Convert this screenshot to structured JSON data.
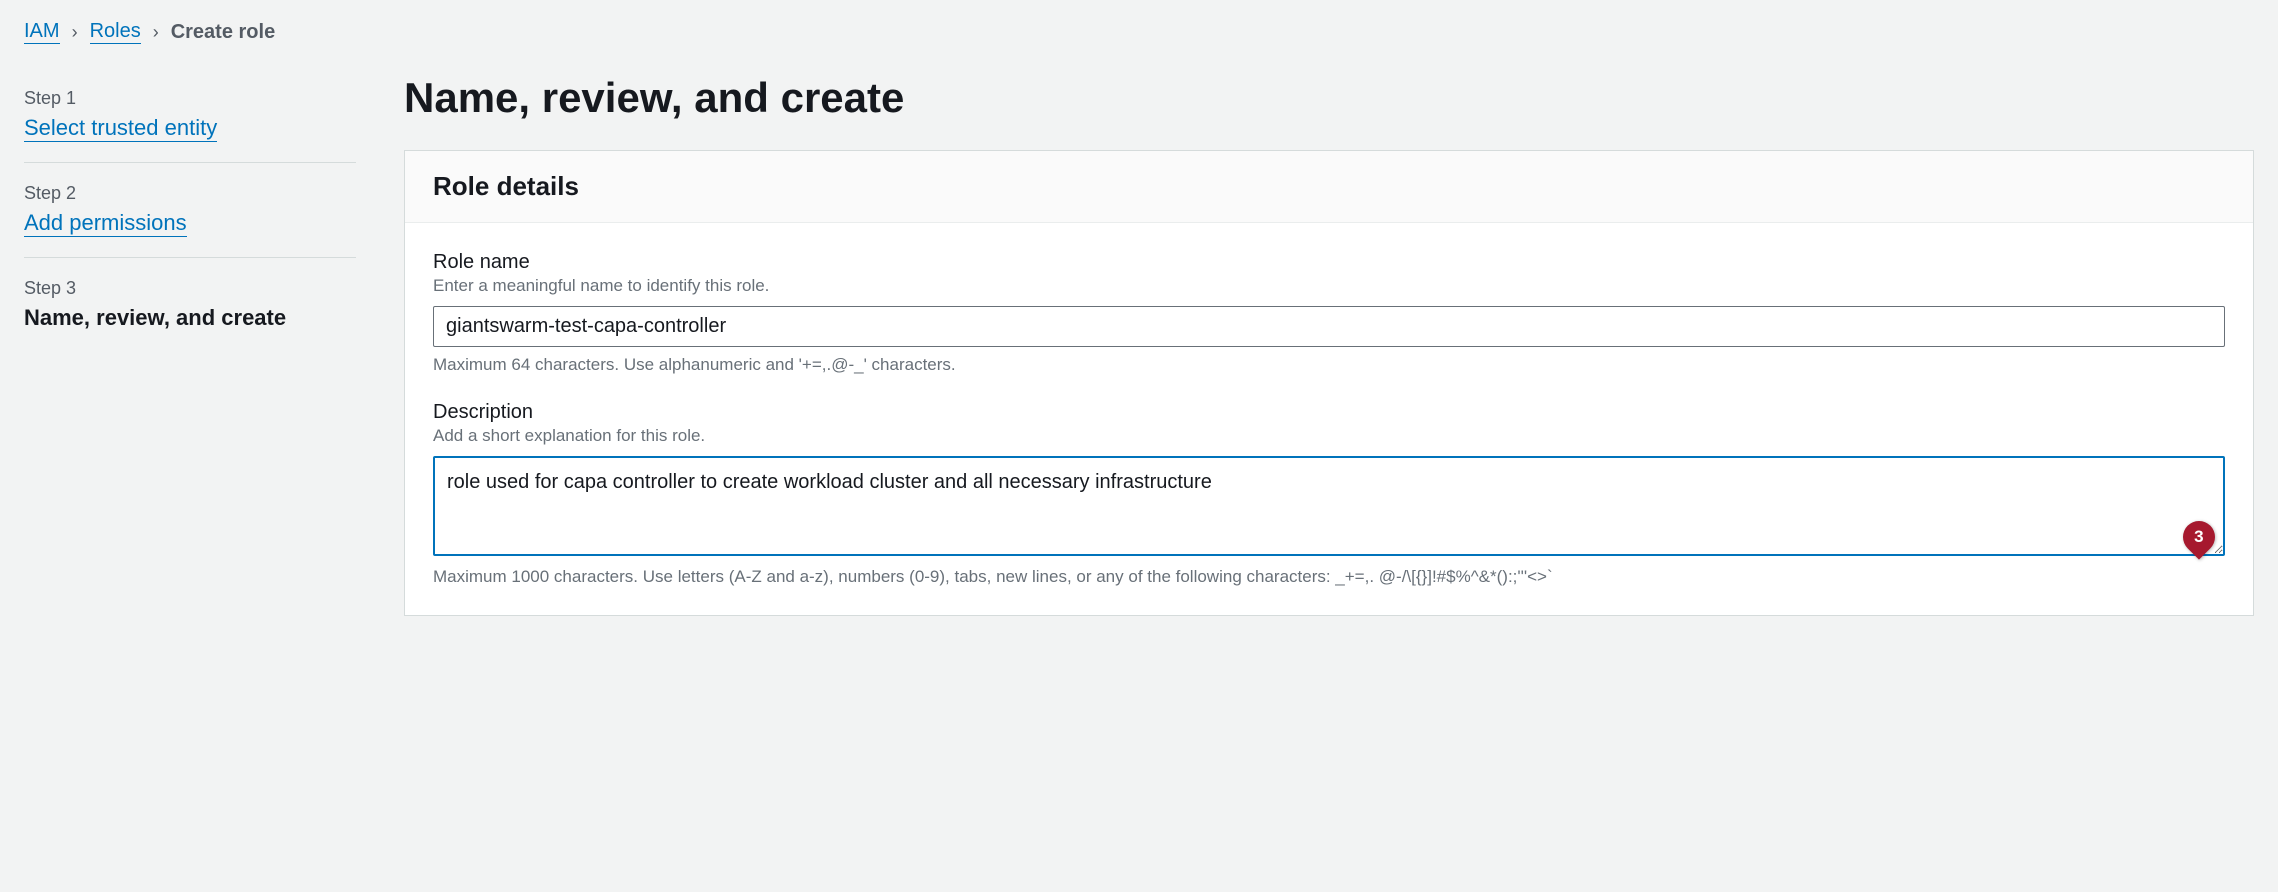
{
  "breadcrumb": {
    "items": [
      {
        "label": "IAM",
        "link": true
      },
      {
        "label": "Roles",
        "link": true
      },
      {
        "label": "Create role",
        "link": false
      }
    ]
  },
  "sidebar": {
    "steps": [
      {
        "step_label": "Step 1",
        "title": "Select trusted entity",
        "active": false,
        "link": true
      },
      {
        "step_label": "Step 2",
        "title": "Add permissions",
        "active": false,
        "link": true
      },
      {
        "step_label": "Step 3",
        "title": "Name, review, and create",
        "active": true,
        "link": false
      }
    ]
  },
  "page_title": "Name, review, and create",
  "panel": {
    "title": "Role details",
    "role_name": {
      "label": "Role name",
      "hint": "Enter a meaningful name to identify this role.",
      "value": "giantswarm-test-capa-controller",
      "help": "Maximum 64 characters. Use alphanumeric and '+=,.@-_' characters."
    },
    "description": {
      "label": "Description",
      "hint": "Add a short explanation for this role.",
      "value": "role used for capa controller to create workload cluster and all necessary infrastructure",
      "help": "Maximum 1000 characters. Use letters (A-Z and a-z), numbers (0-9), tabs, new lines, or any of the following characters: _+=,. @-/\\[{}]!#$%^&*():;'''<>`",
      "badge_count": "3"
    }
  }
}
